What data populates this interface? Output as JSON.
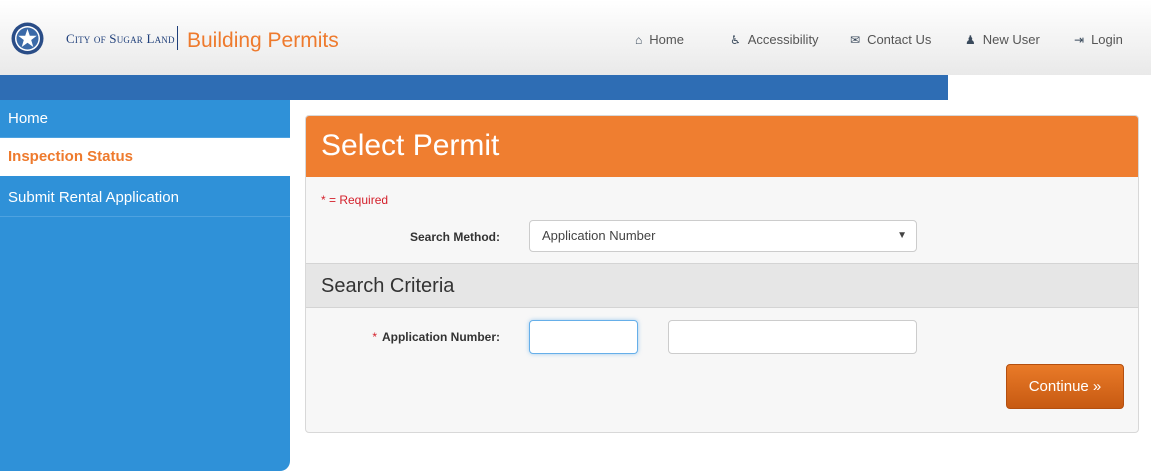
{
  "header": {
    "city_brand": "City of Sugar Land",
    "title": "Building Permits",
    "nav": {
      "home": "Home",
      "accessibility": "Accessibility",
      "contact": "Contact Us",
      "new_user": "New User",
      "login": "Login"
    }
  },
  "sidebar": {
    "items": [
      {
        "label": "Home"
      },
      {
        "label": "Inspection Status"
      },
      {
        "label": "Submit Rental Application"
      }
    ],
    "active": "Inspection Status"
  },
  "panel": {
    "title": "Select Permit",
    "required_note": "* = Required",
    "search_method_label": "Search Method:",
    "search_method_value": "Application Number",
    "criteria_title": "Search Criteria",
    "application_number_label": "Application Number:",
    "application_number_required_mark": "*",
    "application_number_part1": "",
    "application_number_part2": "",
    "continue_label": "Continue »"
  },
  "colors": {
    "accent_orange": "#ef7e30",
    "sidebar_blue": "#2f91d8",
    "header_band_blue": "#2e6db4",
    "required_red": "#d4202b"
  },
  "icons": {
    "home": "home-icon",
    "accessibility": "wheelchair-icon",
    "contact": "envelope-icon",
    "new_user": "user-icon",
    "login": "login-icon",
    "select": "chevron-down-icon",
    "logo": "city-seal-logo"
  }
}
